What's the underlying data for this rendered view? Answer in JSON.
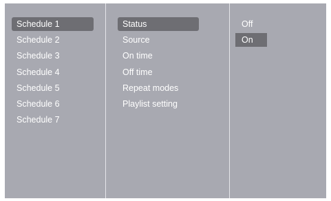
{
  "schedules": {
    "items": [
      {
        "label": "Schedule 1",
        "selected": true
      },
      {
        "label": "Schedule 2",
        "selected": false
      },
      {
        "label": "Schedule 3",
        "selected": false
      },
      {
        "label": "Schedule 4",
        "selected": false
      },
      {
        "label": "Schedule 5",
        "selected": false
      },
      {
        "label": "Schedule 6",
        "selected": false
      },
      {
        "label": "Schedule 7",
        "selected": false
      }
    ]
  },
  "settings": {
    "items": [
      {
        "label": "Status",
        "selected": true
      },
      {
        "label": "Source",
        "selected": false
      },
      {
        "label": "On time",
        "selected": false
      },
      {
        "label": "Off time",
        "selected": false
      },
      {
        "label": "Repeat modes",
        "selected": false
      },
      {
        "label": "Playlist setting",
        "selected": false
      }
    ]
  },
  "status_options": {
    "items": [
      {
        "label": "Off",
        "selected": false
      },
      {
        "label": "On",
        "selected": true
      }
    ]
  },
  "colors": {
    "panel_background": "#a8a9b1",
    "highlight": "#6e6e73",
    "text": "#ffffff",
    "divider": "#e6e6ea"
  }
}
